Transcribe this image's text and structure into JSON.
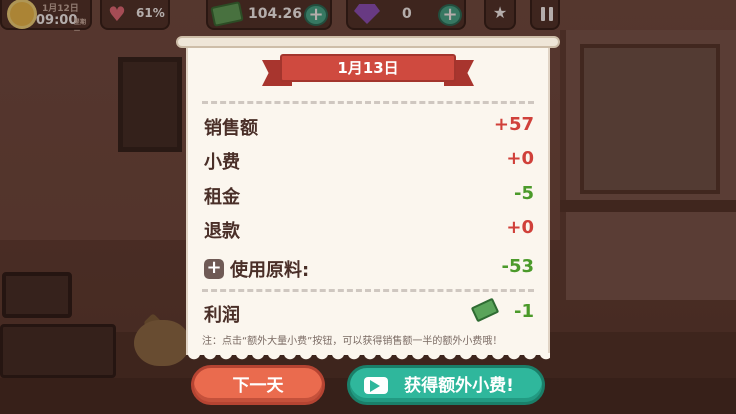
{
  "hud": {
    "date": "1月12日",
    "time": "09:00",
    "weekday": "星期一",
    "mood": "61%",
    "cash": "104.26",
    "gems": "0",
    "plus": "+"
  },
  "receipt": {
    "date_title": "1月13日",
    "rows": [
      {
        "label": "销售额",
        "value": "+57"
      },
      {
        "label": "小费",
        "value": "+0"
      },
      {
        "label": "租金",
        "value": "-5"
      },
      {
        "label": "退款",
        "value": "+0"
      },
      {
        "label": "使用原料:",
        "value": "-53"
      }
    ],
    "profit": {
      "label": "利润",
      "value": "-1"
    },
    "note": "注：点击“额外大量小费”按钮，可以获得销售额一半的额外小费哦！"
  },
  "buttons": {
    "next_day": "下一天",
    "extra_tips": "获得额外小费!"
  },
  "colors": {
    "ribbon": "#cf4a3f",
    "positive": "#d0403a",
    "negative": "#4b9a2a",
    "next_button": "#ea6b4e",
    "tips_button": "#2fb79c"
  },
  "icons": [
    "sun-icon",
    "heart-icon",
    "cash-icon",
    "gem-icon",
    "book-icon",
    "pause-icon",
    "medkit-icon",
    "video-camera-icon"
  ]
}
